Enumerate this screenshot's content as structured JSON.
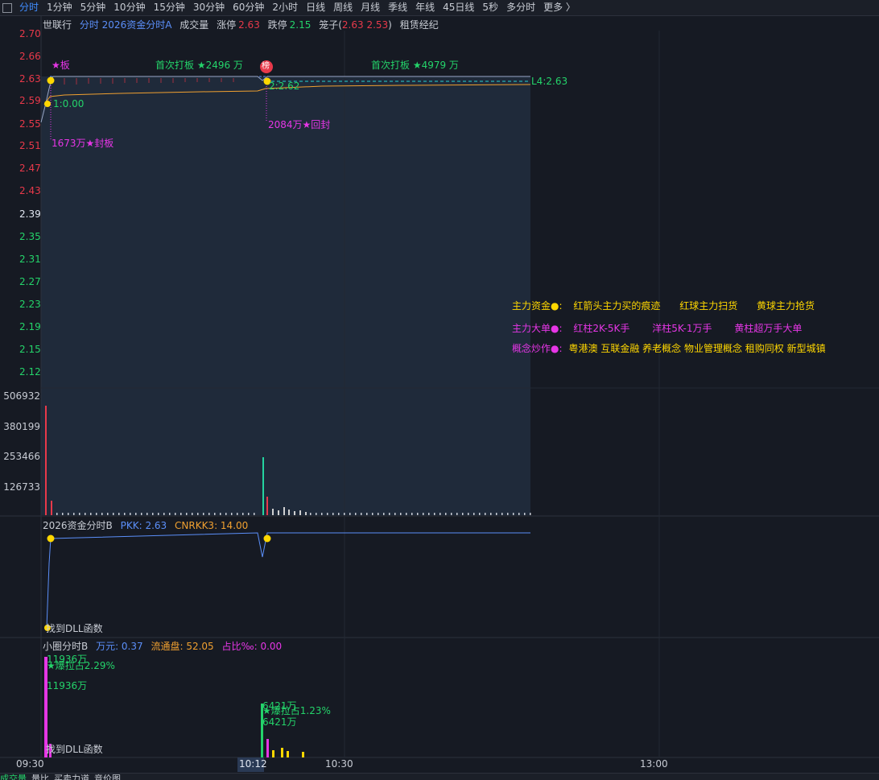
{
  "toolbar": {
    "tabs": [
      "分时",
      "1分钟",
      "5分钟",
      "10分钟",
      "15分钟",
      "30分钟",
      "60分钟",
      "2小时",
      "日线",
      "周线",
      "月线",
      "季线",
      "年线",
      "45日线",
      "5秒",
      "多分时",
      "更多 〉"
    ],
    "active": 0
  },
  "header": {
    "stock": "世联行",
    "indicator": "分时 2026资金分时A",
    "volume_label": "成交量",
    "limit_up_label": "涨停",
    "limit_up": "2.63",
    "limit_down_label": "跌停",
    "limit_down": "2.15",
    "cage_label": "笼子(",
    "cage_values": "2.63 2.53",
    "cage_close": ")",
    "concept": "租赁经纪"
  },
  "price_axis": [
    "2.70",
    "2.66",
    "2.63",
    "2.59",
    "2.55",
    "2.51",
    "2.47",
    "2.43",
    "2.39",
    "2.35",
    "2.31",
    "2.27",
    "2.23",
    "2.19",
    "2.15",
    "2.12"
  ],
  "volume_axis": [
    "506932",
    "380199",
    "253466",
    "126733"
  ],
  "annotations": {
    "star_board": "★板",
    "first_board_1": "首次打板 ★2496 万",
    "bang": "榜",
    "first_board_2": "首次打板 ★4979 万",
    "l4": "L4:2.63",
    "l1": "1:0.00",
    "l2": "2:2.62",
    "seal": "1673万★封板",
    "reseal": "2084万★回封"
  },
  "legend": {
    "row1_title": "主力资金●:",
    "row1_items": [
      "红箭头主力买的痕迹",
      "红球主力扫货",
      "黄球主力抢货"
    ],
    "row2_title": "主力大单●:",
    "row2_items": [
      "红柱2K-5K手",
      "洋柱5K-1万手",
      "黄柱超万手大单"
    ],
    "row3_title": "概念炒作●:",
    "row3_items": "粤港澳 互联金融 养老概念 物业管理概念 租购同权 新型城镇"
  },
  "sub1": {
    "title": "2026资金分时B",
    "pkk": "PKK: 2.63",
    "cnrkk": "CNRKK3: 14.00",
    "dll": "找到DLL函数"
  },
  "sub2": {
    "title": "小圈分时B",
    "wan": "万元: 0.37",
    "float": "流通盘: 52.05",
    "ratio": "占比‰: 0.00",
    "a1": "11936万",
    "a2": "★爆拉占2.29%",
    "a3": "11936万",
    "b1": "6421万",
    "b2": "★爆拉占1.23%",
    "b3": "6421万",
    "dll": "找到DLL函数"
  },
  "time_axis": {
    "t0": "09:30",
    "t1": "10:12",
    "t2": "10:30",
    "t3": "13:00"
  },
  "bottom_tabs": [
    "成交量",
    "量比",
    "买卖力道",
    "竞价图"
  ],
  "colors": {
    "up": "#e8394a",
    "down": "#24d36a",
    "neutral": "#c8ccd4",
    "magenta": "#e636e6",
    "yellow": "#ffd700",
    "blue": "#5b8ff9",
    "orange": "#f0a030"
  }
}
